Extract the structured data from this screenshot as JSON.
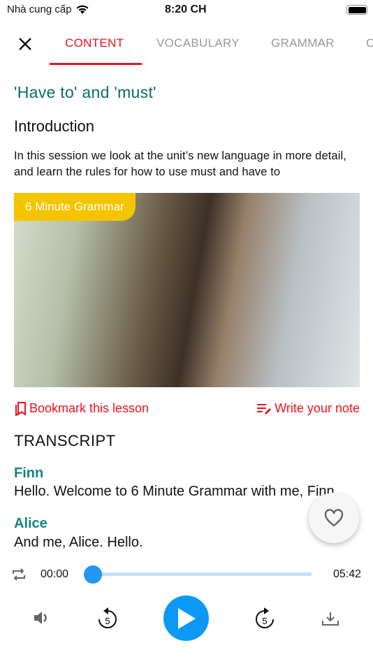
{
  "status_bar": {
    "carrier": "Nhà cung cấp",
    "time": "8:20 CH",
    "battery_level": 1.0
  },
  "tabs": [
    {
      "label": "CONTENT",
      "active": true
    },
    {
      "label": "VOCABULARY"
    },
    {
      "label": "GRAMMAR"
    },
    {
      "label": "C"
    }
  ],
  "colors": {
    "accent": "#e8141d",
    "title": "#0b6b6b",
    "speaker": "#14857f",
    "player": "#2196f3",
    "badge": "#f5c400"
  },
  "lesson": {
    "title": "'Have to' and 'must'",
    "section": "Introduction",
    "description": "In this session we look at the unit’s new language in more detail, and learn the rules for how to use must and have to",
    "badge": "6 Minute Grammar"
  },
  "actions": {
    "bookmark": "Bookmark this lesson",
    "note": "Write your note"
  },
  "transcript": {
    "heading": "TRANSCRIPT",
    "entries": [
      {
        "speaker": "Finn",
        "text": "Hello. Welcome to 6 Minute Grammar with me, Finn."
      },
      {
        "speaker": "Alice",
        "text": "And me, Alice. Hello."
      }
    ]
  },
  "player": {
    "current": "00:00",
    "duration": "05:42",
    "progress_percent": 0,
    "skip_seconds": "5"
  }
}
